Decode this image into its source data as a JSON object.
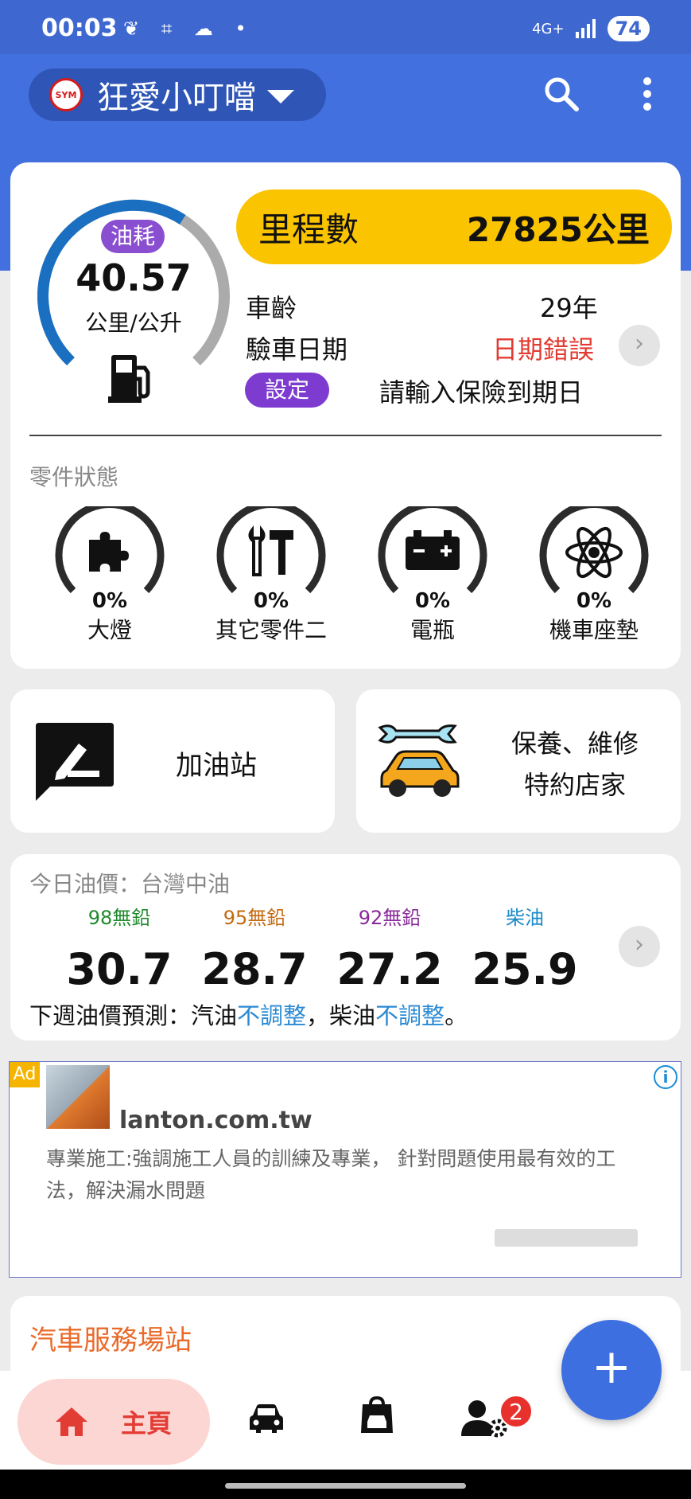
{
  "status_bar": {
    "time": "00:03",
    "network": "4G+",
    "battery": "74"
  },
  "header": {
    "vehicle_name": "狂愛小叮噹",
    "logo_text": "SYM"
  },
  "overview": {
    "fuel_badge": "油耗",
    "fuel_value": "40.57",
    "fuel_unit": "公里/公升",
    "fuel_gauge_level": 0.62,
    "mileage_label": "里程數",
    "mileage_value": "27825公里",
    "age_label": "車齡",
    "age_value": "29年",
    "inspection_label": "驗車日期",
    "inspection_value": "日期錯誤",
    "set_button": "設定",
    "insurance_prompt": "請輸入保險到期日",
    "parts_title": "零件狀態",
    "parts": [
      {
        "percent": "0%",
        "name": "大燈",
        "icon": "puzzle-icon"
      },
      {
        "percent": "0%",
        "name": "其它零件二",
        "icon": "tools-icon"
      },
      {
        "percent": "0%",
        "name": "電瓶",
        "icon": "battery-icon"
      },
      {
        "percent": "0%",
        "name": "機車座墊",
        "icon": "atom-icon"
      }
    ]
  },
  "shortcuts": {
    "gas_station": "加油站",
    "maintenance_line1": "保養、維修",
    "maintenance_line2": "特約店家"
  },
  "fuel_price": {
    "title": "今日油價：台灣中油",
    "items": [
      {
        "name": "98無鉛",
        "value": "30.7",
        "color": "#1f8a2d"
      },
      {
        "name": "95無鉛",
        "value": "28.7",
        "color": "#c46a10"
      },
      {
        "name": "92無鉛",
        "value": "27.2",
        "color": "#8a2a9a"
      },
      {
        "name": "柴油",
        "value": "25.9",
        "color": "#1a8ac8"
      }
    ],
    "forecast_prefix": "下週油價預測：汽油",
    "forecast_gas": "不調整",
    "forecast_mid": "，柴油",
    "forecast_diesel": "不調整",
    "forecast_suffix": "。"
  },
  "ad": {
    "tag": "Ad",
    "domain": "lanton.com.tw",
    "text": "專業施工:強調施工人員的訓練及專業， 針對問題使用最有效的工法，解決漏水問題"
  },
  "service": {
    "title": "汽車服務場站"
  },
  "bottom_nav": {
    "home_label": "主頁",
    "notification_count": "2"
  },
  "fab": {
    "label": "+"
  }
}
